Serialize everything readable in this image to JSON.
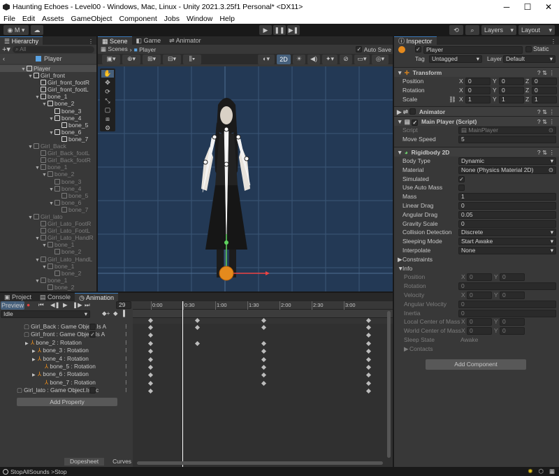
{
  "window": {
    "title": "Haunting Echoes - Level00 - Windows, Mac, Linux - Unity 2021.3.25f1 Personal* <DX11>"
  },
  "menu": [
    "File",
    "Edit",
    "Assets",
    "GameObject",
    "Component",
    "Jobs",
    "Window",
    "Help"
  ],
  "toolbar": {
    "account": "M",
    "layers": "Layers",
    "layout": "Layout"
  },
  "hierarchy": {
    "tab": "Hierarchy",
    "search_placeholder": "All",
    "root": "Player",
    "rows": [
      {
        "indent": 0,
        "arrow": "▼",
        "label": "Player",
        "dim": false,
        "sel": true
      },
      {
        "indent": 1,
        "arrow": "▼",
        "label": "Girl_front",
        "dim": false
      },
      {
        "indent": 2,
        "arrow": "",
        "label": "Girl_front_footR",
        "dim": false
      },
      {
        "indent": 2,
        "arrow": "",
        "label": "Girl_front_footL",
        "dim": false
      },
      {
        "indent": 2,
        "arrow": "▼",
        "label": "bone_1",
        "dim": false
      },
      {
        "indent": 3,
        "arrow": "▼",
        "label": "bone_2",
        "dim": false
      },
      {
        "indent": 4,
        "arrow": "",
        "label": "bone_3",
        "dim": false
      },
      {
        "indent": 4,
        "arrow": "▼",
        "label": "bone_4",
        "dim": false
      },
      {
        "indent": 5,
        "arrow": "",
        "label": "bone_5",
        "dim": false
      },
      {
        "indent": 4,
        "arrow": "▼",
        "label": "bone_6",
        "dim": false
      },
      {
        "indent": 5,
        "arrow": "",
        "label": "bone_7",
        "dim": false
      },
      {
        "indent": 1,
        "arrow": "▼",
        "label": "Girl_Back",
        "dim": true
      },
      {
        "indent": 2,
        "arrow": "",
        "label": "Girl_Back_footL",
        "dim": true
      },
      {
        "indent": 2,
        "arrow": "",
        "label": "Girl_Back_footR",
        "dim": true
      },
      {
        "indent": 2,
        "arrow": "▼",
        "label": "bone_1",
        "dim": true
      },
      {
        "indent": 3,
        "arrow": "▼",
        "label": "bone_2",
        "dim": true
      },
      {
        "indent": 4,
        "arrow": "",
        "label": "bone_3",
        "dim": true
      },
      {
        "indent": 4,
        "arrow": "▼",
        "label": "bone_4",
        "dim": true
      },
      {
        "indent": 5,
        "arrow": "",
        "label": "bone_5",
        "dim": true
      },
      {
        "indent": 4,
        "arrow": "▼",
        "label": "bone_6",
        "dim": true
      },
      {
        "indent": 5,
        "arrow": "",
        "label": "bone_7",
        "dim": true
      },
      {
        "indent": 1,
        "arrow": "▼",
        "label": "Girl_lato",
        "dim": true
      },
      {
        "indent": 2,
        "arrow": "",
        "label": "Girl_Lato_FootR",
        "dim": true
      },
      {
        "indent": 2,
        "arrow": "",
        "label": "Girl_Lato_FootL",
        "dim": true
      },
      {
        "indent": 2,
        "arrow": "▼",
        "label": "Girl_Lato_HandR",
        "dim": true
      },
      {
        "indent": 3,
        "arrow": "▼",
        "label": "bone_1",
        "dim": true
      },
      {
        "indent": 4,
        "arrow": "",
        "label": "bone_2",
        "dim": true
      },
      {
        "indent": 2,
        "arrow": "▼",
        "label": "Girl_Lato_HandL",
        "dim": true
      },
      {
        "indent": 3,
        "arrow": "▼",
        "label": "bone_1",
        "dim": true
      },
      {
        "indent": 4,
        "arrow": "",
        "label": "bone_2",
        "dim": true
      },
      {
        "indent": 2,
        "arrow": "▼",
        "label": "bone_1",
        "dim": true
      },
      {
        "indent": 3,
        "arrow": "",
        "label": "bone_2",
        "dim": true
      }
    ]
  },
  "scene": {
    "tabs": [
      "Scene",
      "Game",
      "Animator"
    ],
    "breadcrumb_root": "Scenes",
    "breadcrumb_obj": "Player",
    "auto_save": "Auto Save",
    "mode_2d": "2D"
  },
  "inspector": {
    "tab": "Inspector",
    "name": "Player",
    "static": "Static",
    "tag_label": "Tag",
    "tag": "Untagged",
    "layer_label": "Layer",
    "layer": "Default",
    "transform": {
      "title": "Transform",
      "position_label": "Position",
      "rotation_label": "Rotation",
      "scale_label": "Scale",
      "position": {
        "x": "0",
        "y": "0",
        "z": "0"
      },
      "rotation": {
        "x": "0",
        "y": "0",
        "z": "0"
      },
      "scale": {
        "x": "1",
        "y": "1",
        "z": "1"
      }
    },
    "animator": {
      "title": "Animator"
    },
    "main_player": {
      "title": "Main Player (Script)",
      "script_label": "Script",
      "script": "MainPlayer",
      "speed_label": "Move Speed",
      "speed": "5"
    },
    "rigidbody": {
      "title": "Rigidbody 2D",
      "rows": [
        {
          "label": "Body Type",
          "value": "Dynamic",
          "kind": "dropdown"
        },
        {
          "label": "Material",
          "value": "None (Physics Material 2D)",
          "kind": "object"
        },
        {
          "label": "Simulated",
          "value": "✓",
          "kind": "check"
        },
        {
          "label": "Use Auto Mass",
          "value": "",
          "kind": "check"
        },
        {
          "label": "Mass",
          "value": "1",
          "kind": "field"
        },
        {
          "label": "Linear Drag",
          "value": "0",
          "kind": "field"
        },
        {
          "label": "Angular Drag",
          "value": "0.05",
          "kind": "field"
        },
        {
          "label": "Gravity Scale",
          "value": "0",
          "kind": "field"
        },
        {
          "label": "Collision Detection",
          "value": "Discrete",
          "kind": "dropdown"
        },
        {
          "label": "Sleeping Mode",
          "value": "Start Awake",
          "kind": "dropdown"
        },
        {
          "label": "Interpolate",
          "value": "None",
          "kind": "dropdown"
        }
      ]
    },
    "constraints": "Constraints",
    "info": {
      "title": "Info",
      "position_label": "Position",
      "rotation_label": "Rotation",
      "velocity_label": "Velocity",
      "angular_velocity_label": "Angular Velocity",
      "inertia_label": "Inertia",
      "local_com_label": "Local Center of Mass",
      "world_com_label": "World Center of Mass",
      "sleep_state_label": "Sleep State",
      "sleep_state": "Awake",
      "position": {
        "x": "0",
        "y": "0"
      },
      "rotation": "0",
      "velocity": {
        "x": "0",
        "y": "0"
      },
      "angular_velocity": "0",
      "inertia": "0",
      "local_com": {
        "x": "0",
        "y": "0"
      },
      "world_com": {
        "x": "0",
        "y": "0"
      },
      "contacts": "Contacts"
    },
    "add_component": "Add Component"
  },
  "animation": {
    "tabs": [
      "Project",
      "Console",
      "Animation"
    ],
    "preview": "Preview",
    "frame": "29",
    "clip": "Idle",
    "ticks": [
      "0:00",
      "0:30",
      "1:00",
      "1:30",
      "2:00",
      "2:30",
      "3:00"
    ],
    "properties": [
      {
        "label": "Girl_Back : Game Object.Is A",
        "indent": 1,
        "check": true,
        "checked": false,
        "arrow": "",
        "keys": [
          0,
          1,
          2,
          3
        ]
      },
      {
        "label": "Girl_front : Game Object.Is A",
        "indent": 1,
        "check": true,
        "checked": true,
        "arrow": "",
        "keys": [
          0,
          3
        ]
      },
      {
        "label": "bone_2 : Rotation",
        "indent": 2,
        "check": false,
        "arrow": "▶",
        "keys": [
          0,
          1,
          2,
          3
        ]
      },
      {
        "label": "bone_3 : Rotation",
        "indent": 3,
        "check": false,
        "arrow": "▶",
        "keys": [
          0,
          2,
          3
        ]
      },
      {
        "label": "bone_4 : Rotation",
        "indent": 3,
        "check": false,
        "arrow": "▶",
        "keys": [
          0,
          2,
          3
        ]
      },
      {
        "label": "bone_5 : Rotation",
        "indent": 4,
        "check": false,
        "arrow": "",
        "keys": [
          0,
          2,
          3
        ]
      },
      {
        "label": "bone_6 : Rotation",
        "indent": 3,
        "check": false,
        "arrow": "▶",
        "keys": [
          0,
          2,
          3
        ]
      },
      {
        "label": "bone_7 : Rotation",
        "indent": 4,
        "check": false,
        "arrow": "",
        "keys": [
          0,
          2,
          3
        ]
      },
      {
        "label": "Girl_lato : Game Object.Is Ac",
        "indent": 0,
        "check": true,
        "checked": false,
        "arrow": "",
        "keys": [
          0,
          3
        ]
      }
    ],
    "add_property": "Add Property",
    "dopesheet": "Dopesheet",
    "curves": "Curves"
  },
  "status": {
    "message": "StopAllSounds >Stop"
  }
}
